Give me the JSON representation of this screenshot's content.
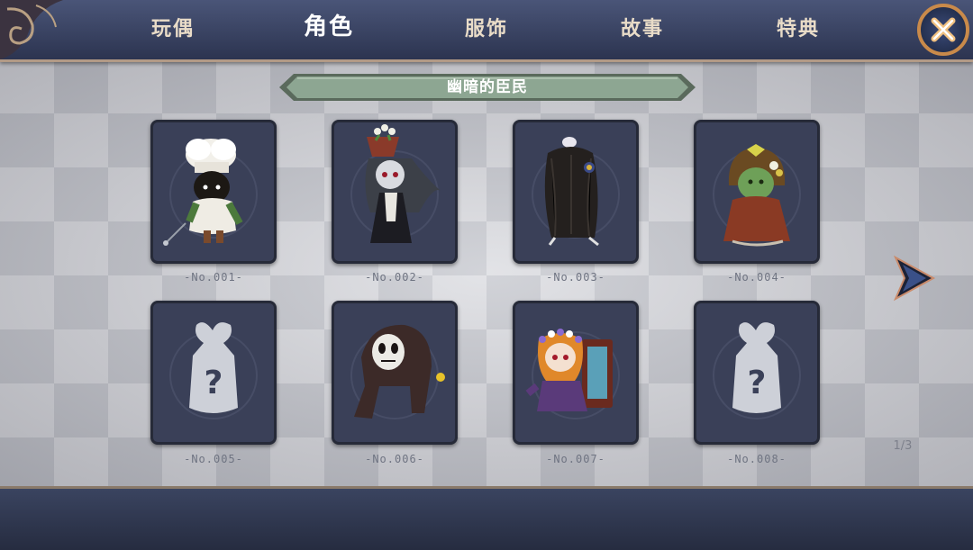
{
  "tabs": [
    {
      "label": "玩偶",
      "active": false
    },
    {
      "label": "角色",
      "active": true
    },
    {
      "label": "服饰",
      "active": false
    },
    {
      "label": "故事",
      "active": false
    },
    {
      "label": "特典",
      "active": false
    }
  ],
  "section_title": "幽暗的臣民",
  "cards": [
    {
      "number": "-No.001-",
      "locked": false,
      "icon": "chef-character-icon"
    },
    {
      "number": "-No.002-",
      "locked": false,
      "icon": "flowerpot-girl-character-icon"
    },
    {
      "number": "-No.003-",
      "locked": false,
      "icon": "long-hair-ghost-character-icon"
    },
    {
      "number": "-No.004-",
      "locked": false,
      "icon": "zombie-hood-character-icon"
    },
    {
      "number": "-No.005-",
      "locked": true,
      "icon": "unknown-character-icon"
    },
    {
      "number": "-No.006-",
      "locked": false,
      "icon": "masked-creature-character-icon"
    },
    {
      "number": "-No.007-",
      "locked": false,
      "icon": "flower-crown-girl-character-icon"
    },
    {
      "number": "-No.008-",
      "locked": true,
      "icon": "unknown-character-icon"
    }
  ],
  "pager": "1/3",
  "icons": {
    "close": "close-icon",
    "next": "next-page-arrow-icon"
  },
  "colors": {
    "accent_close": "#c98a4a",
    "ribbon": "#8da692",
    "card_bg": "#3a4058"
  }
}
